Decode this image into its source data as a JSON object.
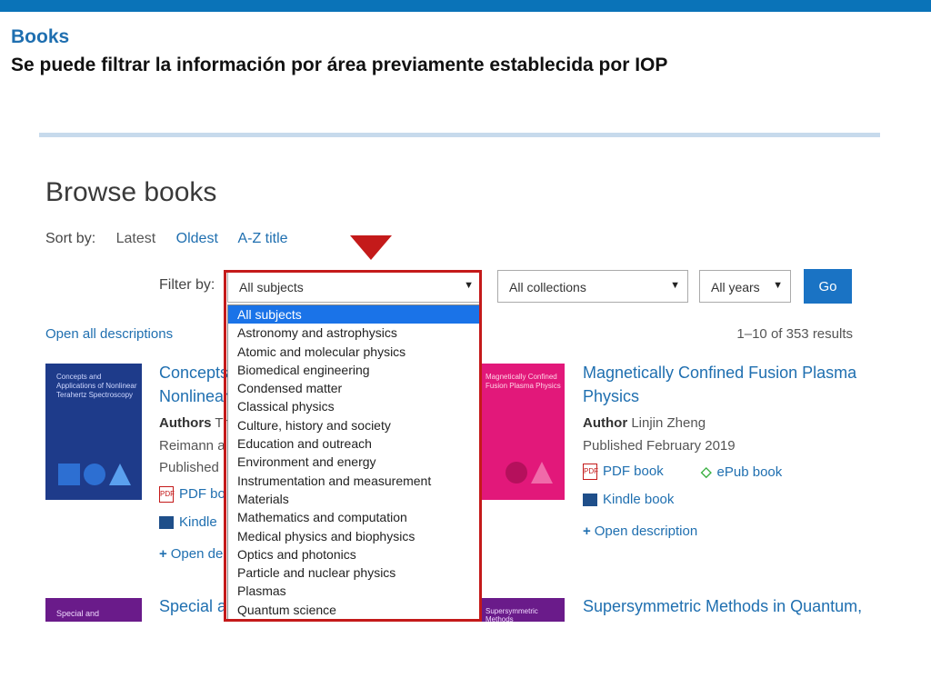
{
  "slide": {
    "title": "Books",
    "subtitle": "Se puede filtrar la información por área previamente establecida por IOP"
  },
  "page": {
    "heading": "Browse books",
    "sort": {
      "label": "Sort by:",
      "latest": "Latest",
      "oldest": "Oldest",
      "az": "A-Z title"
    },
    "filter": {
      "label": "Filter by:",
      "subjects_value": "All subjects",
      "collections_value": "All collections",
      "years_value": "All years",
      "go_label": "Go"
    },
    "dropdown_options": [
      "All subjects",
      "Astronomy and astrophysics",
      "Atomic and molecular physics",
      "Biomedical engineering",
      "Condensed matter",
      "Classical physics",
      "Culture, history and society",
      "Education and outreach",
      "Environment and energy",
      "Instrumentation and measurement",
      "Materials",
      "Mathematics and computation",
      "Medical physics and biophysics",
      "Optics and photonics",
      "Particle and nuclear physics",
      "Plasmas",
      "Quantum science"
    ],
    "open_all": "Open all descriptions",
    "results": "1–10 of 353 results"
  },
  "books": {
    "left": {
      "cover_text": "Concepts and Applications of Nonlinear Terahertz Spectroscopy",
      "title_line1": "Concepts",
      "title_line2": "Nonlinear",
      "authors_label": "Authors",
      "authors_value": "Th",
      "authors_cont": "Reimann a",
      "published": "Published",
      "pdf": "PDF bo",
      "kindle": "Kindle",
      "open": "Open de"
    },
    "right": {
      "cover_text": "Magnetically Confined Fusion Plasma Physics",
      "title_line1": "Magnetically Confined Fusion Plasma",
      "title_line2": "Physics",
      "author_label": "Author",
      "author_value": "Linjin Zheng",
      "published": "Published February 2019",
      "pdf": "PDF book",
      "epub": "ePub book",
      "kindle": "Kindle book",
      "open": "Open description"
    },
    "bottom_left": {
      "cover_text": "Special and",
      "title": "Special a"
    },
    "bottom_right": {
      "cover_text": "Supersymmetric Methods",
      "title": "Supersymmetric Methods in Quantum,"
    }
  }
}
